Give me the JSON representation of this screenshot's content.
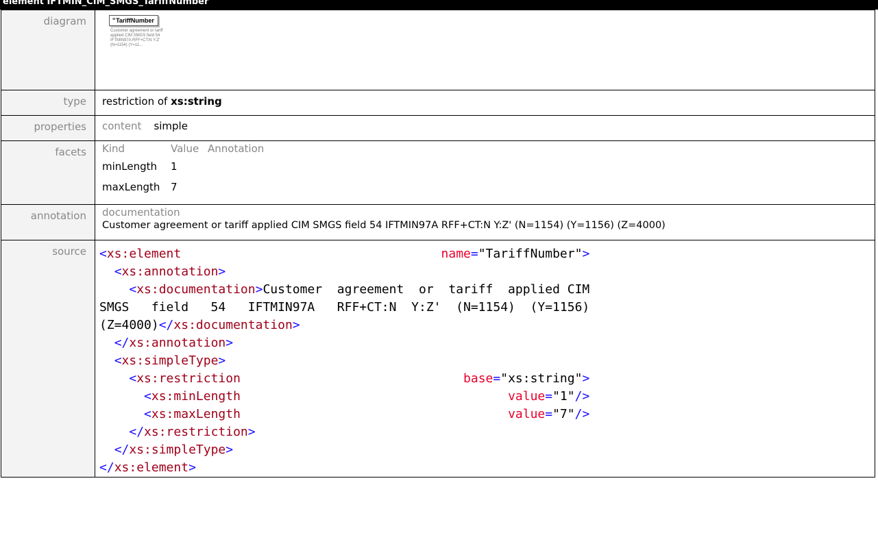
{
  "header": {
    "title": "element IFTMIN_CIM_SMGS_TariffNumber"
  },
  "rows": {
    "diagram": {
      "label": "diagram",
      "element_name": "TariffNumber",
      "doc_preview": "Customer agreement or tariff applied CIM SMGS field 54 IFTMIN97A RFF+CT:N Y:Z' (N=1154) (Y=11..."
    },
    "type": {
      "label": "type",
      "prefix": "restriction of",
      "base": "xs:string"
    },
    "properties": {
      "label": "properties",
      "key": "content",
      "value": "simple"
    },
    "facets": {
      "label": "facets",
      "headers": [
        "Kind",
        "Value",
        "Annotation"
      ],
      "items": [
        {
          "kind": "minLength",
          "value": "1"
        },
        {
          "kind": "maxLength",
          "value": "7"
        }
      ]
    },
    "annotation": {
      "label": "annotation",
      "key": "documentation",
      "text": "Customer agreement or tariff applied CIM SMGS field 54 IFTMIN97A RFF+CT:N Y:Z' (N=1154) (Y=1156) (Z=4000)"
    },
    "source": {
      "label": "source",
      "lines": [
        "<xs:element name=\"TariffNumber\">",
        "  <xs:annotation>",
        "    <xs:documentation>Customer agreement or tariff applied CIM SMGS field 54 IFTMIN97A RFF+CT:N Y:Z' (N=1154) (Y=1156) (Z=4000)</xs:documentation>",
        "  </xs:annotation>",
        "  <xs:simpleType>",
        "    <xs:restriction base=\"xs:string\">",
        "      <xs:minLength value=\"1\"/>",
        "      <xs:maxLength value=\"7\"/>",
        "    </xs:restriction>",
        "  </xs:simpleType>",
        "</xs:element>"
      ]
    }
  }
}
